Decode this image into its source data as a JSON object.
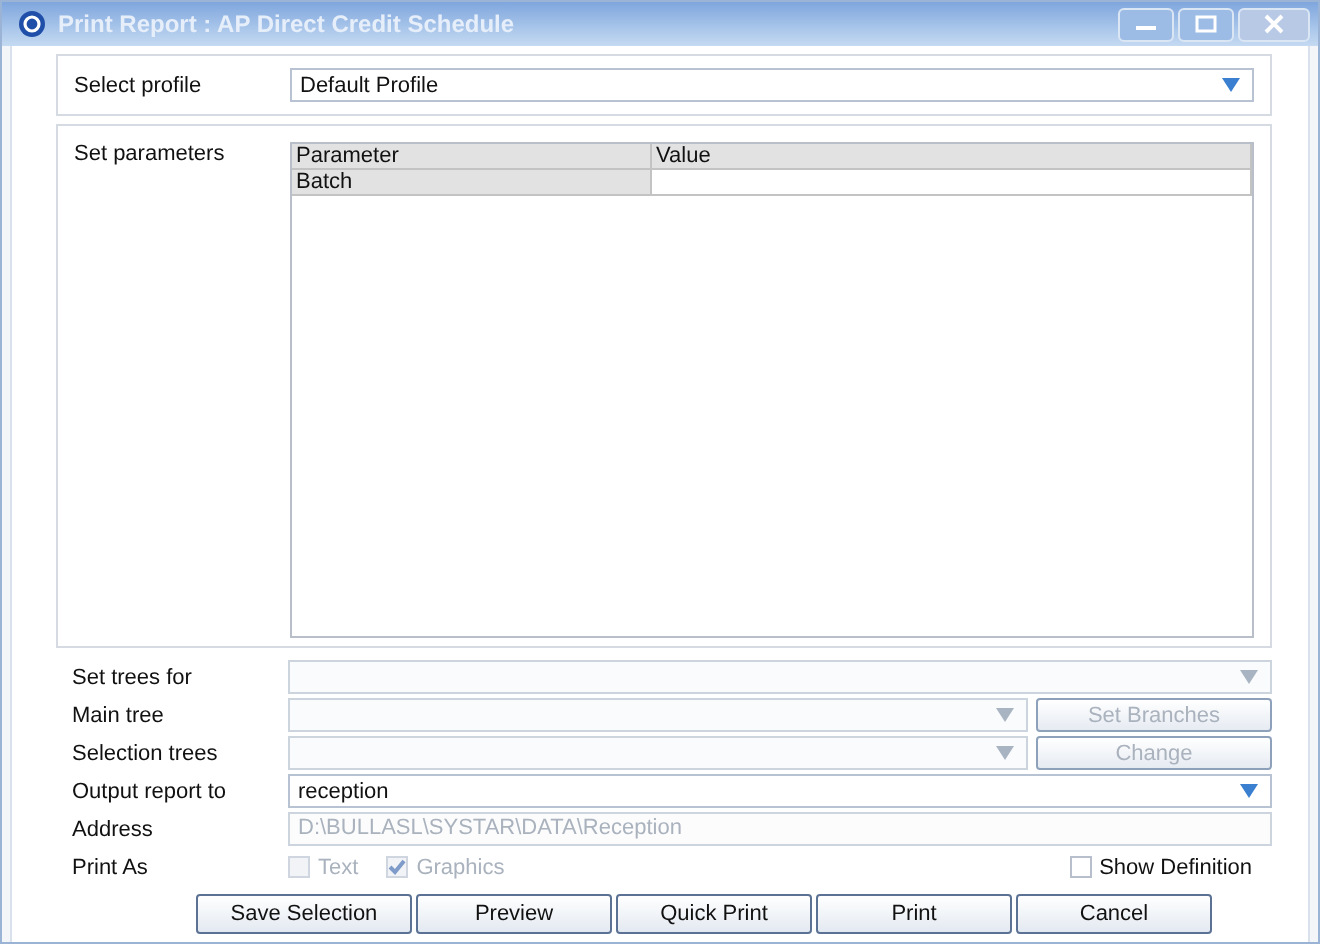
{
  "window": {
    "title": "Print Report : AP Direct Credit Schedule"
  },
  "profile": {
    "label": "Select profile",
    "value": "Default Profile"
  },
  "parameters": {
    "label": "Set parameters",
    "columns": [
      "Parameter",
      "Value"
    ],
    "rows": [
      {
        "parameter": "Batch"
      }
    ]
  },
  "tree_fields": [
    {
      "label": "Set trees for",
      "disabled": true
    },
    {
      "label": "Main tree",
      "disabled": true,
      "button": {
        "label": "Set Branches",
        "disabled": true
      }
    },
    {
      "label": "Selection trees",
      "disabled": true,
      "button": {
        "label": "Change",
        "disabled": true
      }
    }
  ],
  "output": {
    "label": "Output report to",
    "value": "reception",
    "disabled": false
  },
  "address": {
    "label": "Address",
    "value": "D:\\BULLASL\\SYSTAR\\DATA\\Reception",
    "disabled": true
  },
  "print_as": {
    "label": "Print As",
    "options": [
      {
        "label": "Text",
        "checked": false,
        "disabled": true
      },
      {
        "label": "Graphics",
        "checked": true,
        "disabled": true
      }
    ]
  },
  "show_definition": {
    "label": "Show Definition",
    "checked": false
  },
  "buttons": [
    "Save Selection",
    "Preview",
    "Quick Print",
    "Print",
    "Cancel"
  ]
}
